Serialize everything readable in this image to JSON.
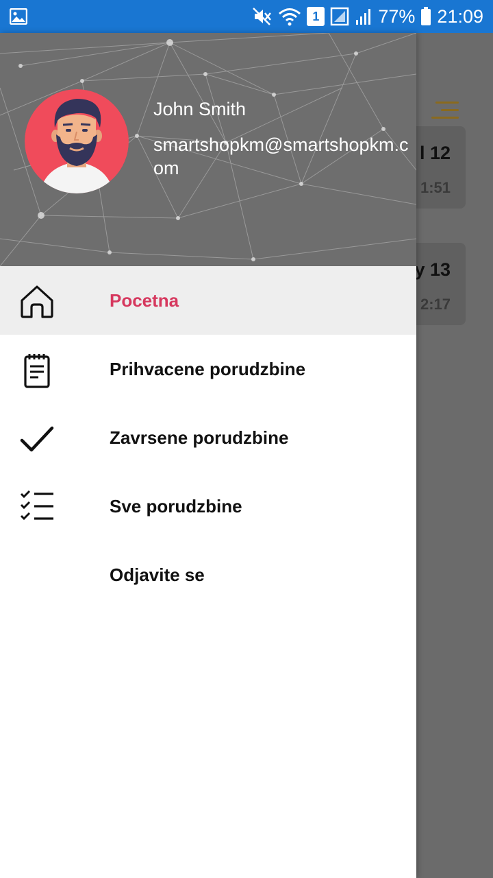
{
  "status_bar": {
    "battery_percent": "77%",
    "time": "21:09",
    "sim_slot": "1",
    "icons": [
      "gallery-icon",
      "mute-icon",
      "wifi-icon",
      "sim-icon",
      "signal-icon",
      "battery-icon"
    ],
    "background_color": "#1976d2"
  },
  "background_app": {
    "cards": [
      {
        "title_fragment": "l 12",
        "time_fragment": "1:51"
      },
      {
        "title_fragment": "y 13",
        "time_fragment": "2:17"
      }
    ],
    "menu_icon": "hamburger-icon"
  },
  "drawer": {
    "user": {
      "name": "John Smith",
      "email": "smartshopkm@smartshopkm.com",
      "avatar_icon": "bearded-man-avatar"
    },
    "menu": [
      {
        "label": "Pocetna",
        "icon": "home-icon",
        "active": true
      },
      {
        "label": "Prihvacene porudzbine",
        "icon": "notepad-icon",
        "active": false
      },
      {
        "label": "Zavrsene porudzbine",
        "icon": "check-icon",
        "active": false
      },
      {
        "label": "Sve porudzbine",
        "icon": "checklist-icon",
        "active": false
      },
      {
        "label": "Odjavite se",
        "icon": "",
        "active": false
      }
    ],
    "accent_color": "#d6385e"
  }
}
